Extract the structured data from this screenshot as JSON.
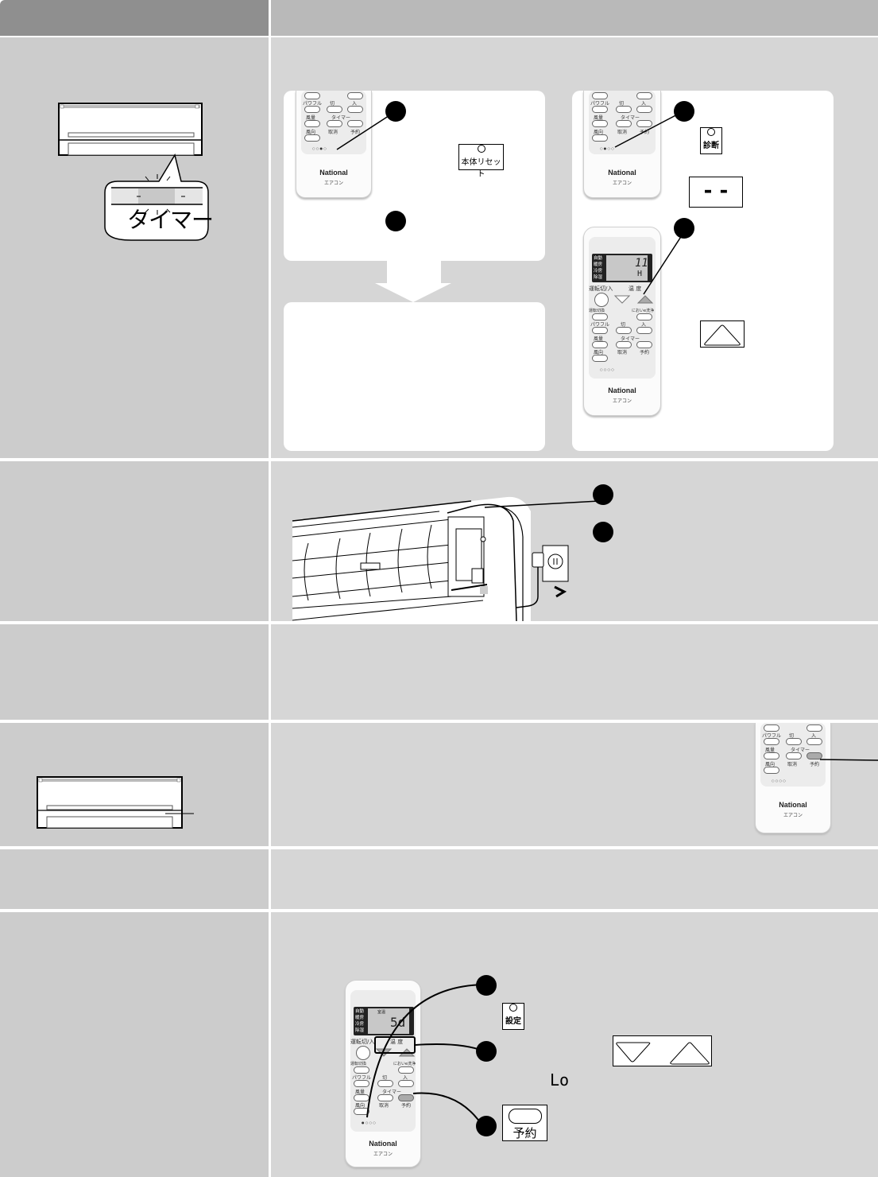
{
  "header": {
    "left_label": "",
    "right_label": ""
  },
  "colors": {
    "header_left": "#8f8f8f",
    "header_right": "#b9b9b9",
    "cell_left": "#cccccc",
    "cell_right": "#d6d6d6",
    "panel": "#ffffff",
    "badge": "#000000"
  },
  "remote": {
    "brand": "National",
    "sub": "エアコン",
    "buttons": {
      "powerful": "パワフル",
      "off": "切",
      "on": "入",
      "fan_speed": "風量",
      "timer": "タイマー",
      "fan_direction": "風向",
      "cancel": "取消",
      "reserve": "予約",
      "mode_switch": "運転切換",
      "odor": "においe洗浄",
      "run_on_off": "運転切/入",
      "temp": "温 度"
    },
    "small_buttons": [
      "設定",
      "診断",
      "本体リセット",
      "リセット"
    ],
    "modes": [
      "自動",
      "暖房",
      "冷房",
      "除湿"
    ]
  },
  "row1": {
    "timer_bubble_label": "タイマー",
    "panel_a": {
      "reset_button_label": "本体リセット"
    },
    "panel_b": {
      "diag_button_label": "診断",
      "display_dashes": "- -",
      "lcd_value_top": "11",
      "lcd_value_bottom": "H"
    }
  },
  "row7": {
    "lcd_value": "5d",
    "lcd_small": "室温",
    "set_button_label": "設定",
    "display_lo": "Lo",
    "reserve_button_label": "予約"
  }
}
